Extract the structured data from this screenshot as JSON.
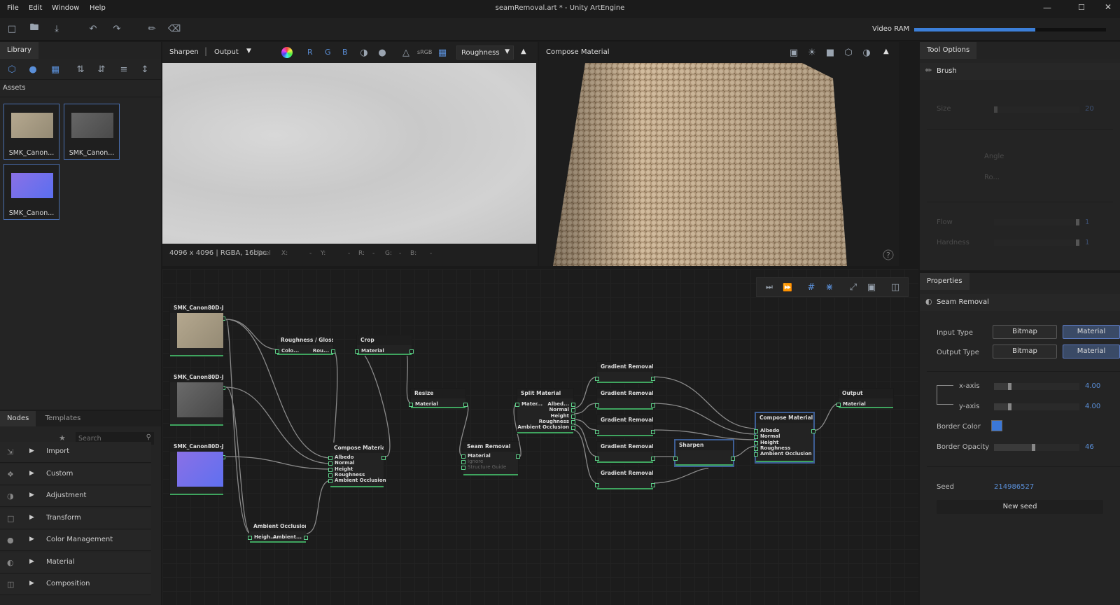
{
  "menu": {
    "file": "File",
    "edit": "Edit",
    "window": "Window",
    "help": "Help"
  },
  "window_title": "seamRemoval.art * - Unity ArtEngine",
  "video_ram_label": "Video RAM",
  "video_ram_fraction": 0.63,
  "library": {
    "tab": "Library",
    "assets_label": "Assets",
    "assets": [
      {
        "name": "SMK_Canon..."
      },
      {
        "name": "SMK_Canon..."
      },
      {
        "name": "SMK_Canon..."
      }
    ]
  },
  "nodes_panel": {
    "tab_nodes": "Nodes",
    "tab_templates": "Templates",
    "search_placeholder": "Search",
    "items": [
      {
        "label": "Import",
        "icon": "import-icon"
      },
      {
        "label": "Custom",
        "icon": "custom-icon"
      },
      {
        "label": "Adjustment",
        "icon": "adjustment-icon"
      },
      {
        "label": "Transform",
        "icon": "transform-icon"
      },
      {
        "label": "Color Management",
        "icon": "color-management-icon"
      },
      {
        "label": "Material",
        "icon": "material-icon"
      },
      {
        "label": "Composition",
        "icon": "composition-icon"
      }
    ]
  },
  "viewer2d": {
    "node": "Sharpen",
    "output": "Output",
    "channels": [
      "R",
      "G",
      "B"
    ],
    "srgb": "sRGB",
    "channel_select": "Roughness",
    "status": "4096 x 4096 |  RGBA, 16bpc",
    "pixel": "Pixel",
    "x": "X:",
    "x_val": "-",
    "y": "Y:",
    "y_val": "-",
    "r": "R:",
    "r_val": "-",
    "g": "G:",
    "g_val": "-",
    "b": "B:",
    "b_val": "-"
  },
  "viewer3d": {
    "title": "Compose Material",
    "help": "?"
  },
  "tool_options": {
    "tab": "Tool Options",
    "tool": "Brush",
    "size_label": "Size",
    "size_value": "20",
    "angle_label": "Angle",
    "ro_label": "Ro...",
    "flow_label": "Flow",
    "flow_value": "1",
    "hardness_label": "Hardness",
    "hardness_value": "1"
  },
  "properties": {
    "tab": "Properties",
    "node": "Seam Removal",
    "input_type_label": "Input Type",
    "output_type_label": "Output Type",
    "bitmap": "Bitmap",
    "material": "Material",
    "xaxis_label": "x-axis",
    "xaxis_value": "4.00",
    "yaxis_label": "y-axis",
    "yaxis_value": "4.00",
    "border_color_label": "Border Color",
    "border_color": "#3b78d8",
    "border_opacity_label": "Border Opacity",
    "border_opacity_value": "46",
    "seed_label": "Seed",
    "seed_value": "214986527",
    "new_seed": "New seed"
  },
  "graph": {
    "img1": "SMK_Canon80D-JPEG",
    "img2": "SMK_Canon80D-JPEG",
    "img3": "SMK_Canon80D-JPEG",
    "rough": "Roughness / Gloss...",
    "rough_in": "Colo...",
    "rough_out": "Rou...",
    "crop": "Crop",
    "resize": "Resize",
    "material": "Material",
    "compose1": "Compose Material",
    "albedo": "Albedo",
    "normal": "Normal",
    "height": "Height",
    "roughness": "Roughness",
    "ao": "Ambient Occlusion",
    "ao_node": "Ambient Occlusion...",
    "ao_in": "Heigh...",
    "ao_out": "Ambient...",
    "seam": "Seam Removal",
    "ignore": "Ignore",
    "structure": "Structure Guide",
    "split": "Split Material",
    "split_in": "Mater...",
    "albed": "Albed...",
    "gr": "Gradient Removal",
    "sharpen": "Sharpen",
    "compose2": "Compose Material",
    "output": "Output"
  }
}
